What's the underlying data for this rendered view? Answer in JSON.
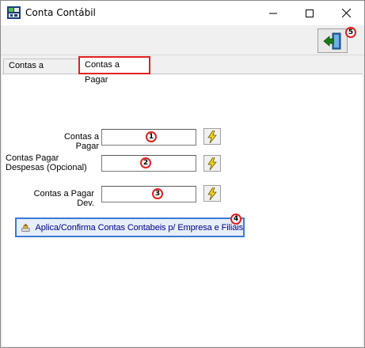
{
  "window": {
    "title": "Conta Contábil"
  },
  "tabs": [
    {
      "label": "Contas a Receber"
    },
    {
      "label": "Contas a Pagar"
    }
  ],
  "form": {
    "rows": [
      {
        "label": "Contas a Pagar",
        "value": "",
        "marker": "1"
      },
      {
        "label_line1": "Contas Pagar",
        "label_line2": "Despesas (Opcional)",
        "value": "",
        "marker": "2"
      },
      {
        "label": "Contas a Pagar Dev.",
        "value": "",
        "marker": "3"
      }
    ],
    "apply_button": {
      "label": "Aplica/Confirma Contas Contabeis p/ Empresa e Filiais",
      "marker": "4"
    }
  },
  "toolbar": {
    "exit_marker": "5"
  },
  "colors": {
    "highlight": "#e02020",
    "apply_text": "#00008b",
    "apply_border": "#3a7bd5"
  }
}
